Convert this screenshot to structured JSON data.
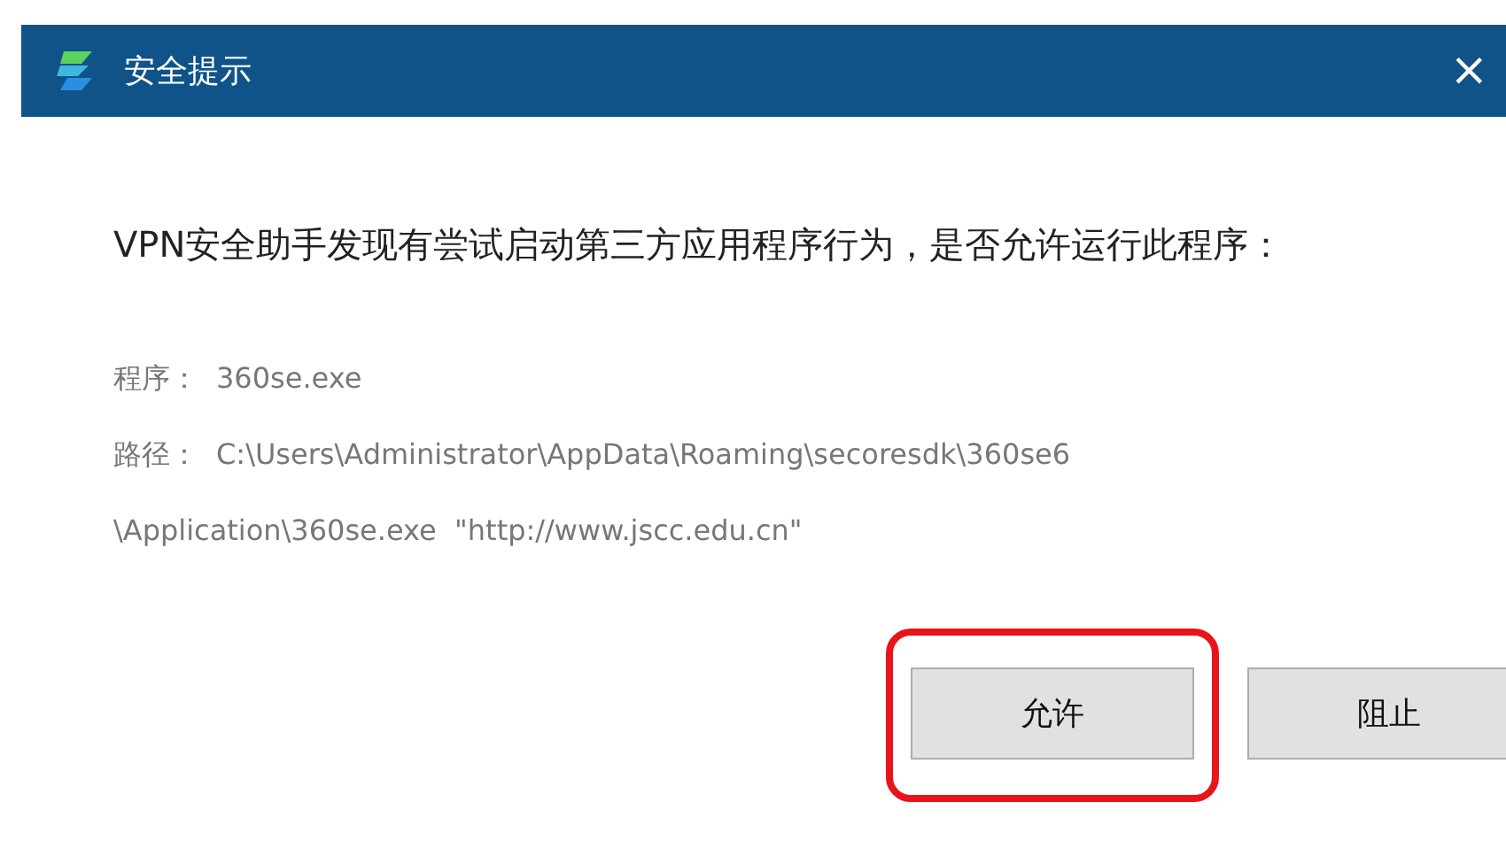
{
  "window": {
    "title": "安全提示",
    "close": "×"
  },
  "message": "VPN安全助手发现有尝试启动第三方应用程序行为，是否允许运行此程序：",
  "details": [
    {
      "label": "程序：",
      "value_lines": [
        "360se.exe"
      ]
    },
    {
      "label": "路径：",
      "value_lines": [
        "C:\\Users\\Administrator\\AppData\\Roaming\\secoresdk\\360se6",
        "\\Application\\360se.exe  \"http://www.jscc.edu.cn\""
      ]
    }
  ],
  "buttons": [
    {
      "label": "允许",
      "highlighted": true
    },
    {
      "label": "阻止",
      "highlighted": false
    }
  ]
}
